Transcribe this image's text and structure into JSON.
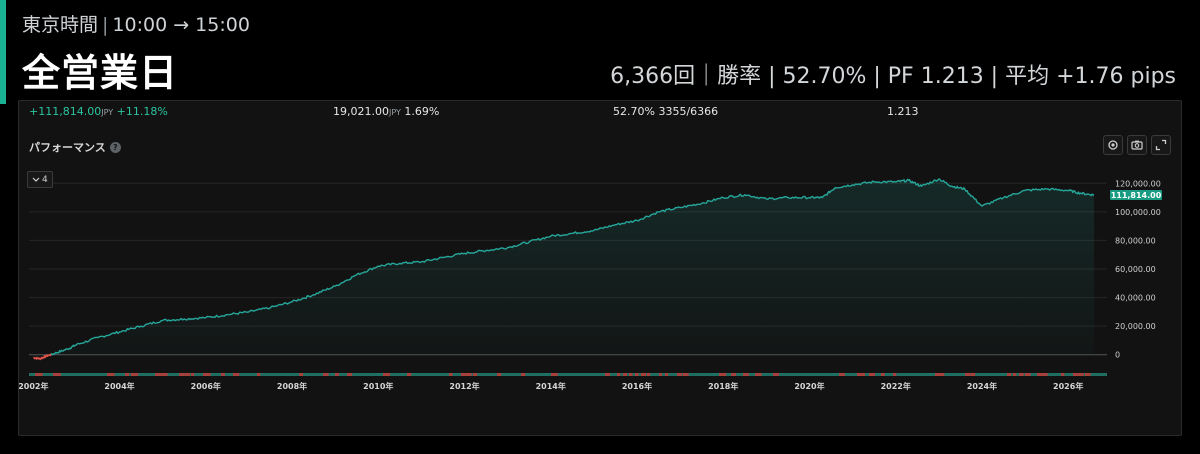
{
  "header": {
    "session_name": "東京時間",
    "session_range": "10:00 → 15:00",
    "title": "全営業日",
    "stats_line": "6,366回｜勝率 | 52.70% | PF 1.213 | 平均 +1.76 pips"
  },
  "summary": {
    "net_profit": "+111,814.00",
    "net_profit_unit": "JPY",
    "net_profit_pct": "+11.18%",
    "max_drawdown": "19,021.00",
    "max_drawdown_unit": "JPY",
    "max_drawdown_pct": "1.69%",
    "win_rate": "52.70%",
    "win_ratio": "3355/6366",
    "profit_factor": "1.213"
  },
  "panel": {
    "title": "パフォーマンス",
    "help_icon": "?",
    "zoom_label": "4"
  },
  "colors": {
    "accent": "#19b394",
    "line": "#26a69a",
    "loss": "#e0534a",
    "label_bg": "#1a9c82"
  },
  "chart_data": {
    "type": "area",
    "x_tick_labels": [
      "2002年",
      "2004年",
      "2006年",
      "2008年",
      "2010年",
      "2012年",
      "2014年",
      "2016年",
      "2018年",
      "2020年",
      "2022年",
      "2024年",
      "2026年"
    ],
    "x_tick_years": [
      2002,
      2004,
      2006,
      2008,
      2010,
      2012,
      2014,
      2016,
      2018,
      2020,
      2022,
      2024,
      2026
    ],
    "xlim": [
      2001.9,
      2026.9
    ],
    "ylim": [
      -10000,
      130000
    ],
    "y_tick_labels": [
      "0",
      "20,000.00",
      "40,000.00",
      "60,000.00",
      "80,000.00",
      "100,000.00",
      "120,000.00"
    ],
    "y_tick_values": [
      0,
      20000,
      40000,
      60000,
      80000,
      100000,
      120000
    ],
    "grid": true,
    "last_value_label": "111,814.00",
    "series": [
      {
        "x": [
          2002.0,
          2002.15,
          2002.3,
          2002.5,
          2002.8,
          2003.0,
          2003.5,
          2004.0,
          2004.5,
          2005.0,
          2005.5,
          2006.0,
          2006.5,
          2007.0,
          2007.5,
          2008.0,
          2008.5,
          2009.0,
          2009.5,
          2010.0,
          2010.5,
          2011.0,
          2011.5,
          2012.0,
          2012.5,
          2013.0,
          2013.5,
          2014.0,
          2014.5,
          2015.0,
          2015.5,
          2016.0,
          2016.5,
          2017.0,
          2017.5,
          2018.0,
          2018.5,
          2019.0,
          2019.5,
          2020.0,
          2020.3,
          2020.6,
          2021.0,
          2021.5,
          2022.0,
          2022.3,
          2022.6,
          2023.0,
          2023.3,
          2023.6,
          2024.0,
          2024.5,
          2025.0,
          2025.5,
          2026.0,
          2026.3,
          2026.6
        ],
        "y": [
          -2000,
          -2800,
          -1000,
          1000,
          4000,
          7000,
          12000,
          16000,
          20000,
          24000,
          25000,
          26000,
          28000,
          30000,
          33000,
          37000,
          42000,
          48000,
          56000,
          62000,
          64000,
          65000,
          68000,
          71000,
          73000,
          75000,
          79000,
          83000,
          85000,
          87000,
          91000,
          94000,
          100000,
          103000,
          106000,
          110000,
          112000,
          109000,
          110000,
          110000,
          110000,
          117000,
          119000,
          121000,
          121000,
          122000,
          118000,
          123000,
          118000,
          116000,
          104000,
          110000,
          115000,
          116000,
          115000,
          113000,
          111814
        ]
      }
    ]
  }
}
